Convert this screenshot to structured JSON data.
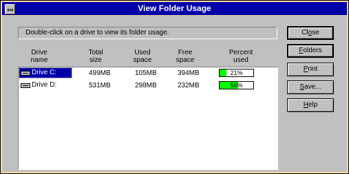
{
  "window": {
    "title": "View Folder Usage"
  },
  "message": "Double-click on a drive to view its folder usage.",
  "columns": {
    "drive_name": [
      "Drive",
      "name"
    ],
    "total_size": [
      "Total",
      "size"
    ],
    "used_space": [
      "Used",
      "space"
    ],
    "free_space": [
      "Free",
      "space"
    ],
    "percent_used": [
      "Percent",
      "used"
    ]
  },
  "drives": [
    {
      "name": "Drive C:",
      "total": "499MB",
      "used": "105MB",
      "free": "394MB",
      "percent_label": "21%",
      "percent_value": 21,
      "selected": true,
      "icon": "drive-icon"
    },
    {
      "name": "Drive D:",
      "total": "531MB",
      "used": "298MB",
      "free": "232MB",
      "percent_label": "56%",
      "percent_value": 56,
      "selected": false,
      "icon": "drive-icon"
    }
  ],
  "buttons": {
    "close": {
      "pre": "Cl",
      "mnemonic": "o",
      "post": "se"
    },
    "folders": {
      "pre": "",
      "mnemonic": "F",
      "post": "olders"
    },
    "print": {
      "pre": "",
      "mnemonic": "P",
      "post": "rint"
    },
    "save": {
      "pre": "",
      "mnemonic": "S",
      "post": "ave..."
    },
    "help": {
      "pre": "",
      "mnemonic": "H",
      "post": "elp"
    }
  },
  "colors": {
    "titlebar": "#0000a8",
    "progress_fill": "#00ff00",
    "face": "#c0c0c0"
  }
}
